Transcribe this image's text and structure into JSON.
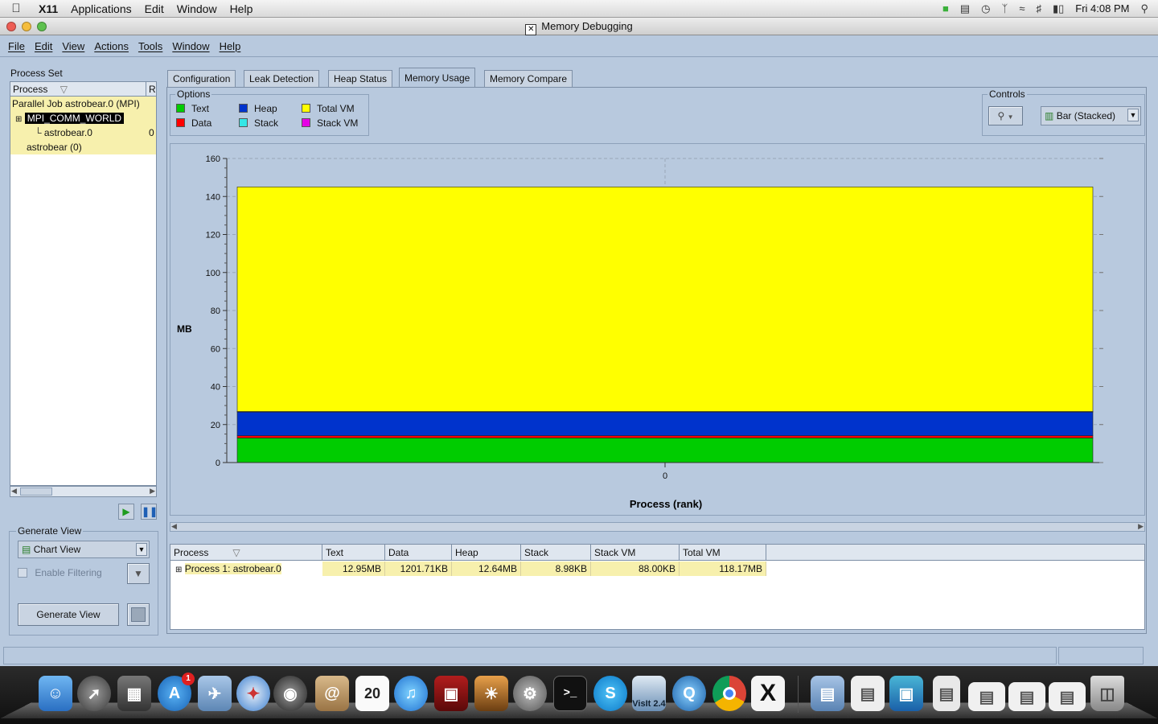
{
  "menubar": {
    "app": "X11",
    "items": [
      "Applications",
      "Edit",
      "Window",
      "Help"
    ],
    "clock": "Fri 4:08 PM"
  },
  "window": {
    "title": "Memory Debugging"
  },
  "app_menu": [
    "File",
    "Edit",
    "View",
    "Actions",
    "Tools",
    "Window",
    "Help"
  ],
  "process_set": {
    "label": "Process Set",
    "col_process": "Process",
    "col_r": "R",
    "rows": {
      "job": "Parallel Job astrobear.0 (MPI)",
      "comm": "MPI_COMM_WORLD",
      "proc": "astrobear.0",
      "proc_rank": "0",
      "bear": "astrobear (0)"
    }
  },
  "generate_view": {
    "label": "Generate View",
    "view_type": "Chart View",
    "enable_filtering": "Enable Filtering",
    "generate_button": "Generate View"
  },
  "tabs": [
    "Configuration",
    "Leak Detection",
    "Heap Status",
    "Memory Usage",
    "Memory Compare"
  ],
  "active_tab": "Memory Usage",
  "options": {
    "label": "Options",
    "items": [
      {
        "name": "Text",
        "color": "#00cc00"
      },
      {
        "name": "Data",
        "color": "#ff0000"
      },
      {
        "name": "Heap",
        "color": "#0033cc"
      },
      {
        "name": "Stack",
        "color": "#33e6e6"
      },
      {
        "name": "Total VM",
        "color": "#ffff00"
      },
      {
        "name": "Stack VM",
        "color": "#e600e6"
      }
    ]
  },
  "controls": {
    "label": "Controls",
    "chart_type": "Bar (Stacked)"
  },
  "chart_data": {
    "type": "bar",
    "stacked": true,
    "categories": [
      "0"
    ],
    "series": [
      {
        "name": "Text",
        "values": [
          12.95
        ],
        "color": "#00cc00"
      },
      {
        "name": "Data",
        "values": [
          1.17
        ],
        "color": "#ff0000"
      },
      {
        "name": "Heap",
        "values": [
          12.64
        ],
        "color": "#0033cc"
      },
      {
        "name": "Stack",
        "values": [
          0.01
        ],
        "color": "#33e6e6"
      },
      {
        "name": "Stack VM",
        "values": [
          0.09
        ],
        "color": "#e600e6"
      },
      {
        "name": "Total VM",
        "values": [
          118.17
        ],
        "color": "#ffff00"
      }
    ],
    "xlabel": "Process (rank)",
    "ylabel": "MB",
    "ylim": [
      0,
      160
    ],
    "yticks": [
      0,
      20,
      40,
      60,
      80,
      100,
      120,
      140,
      160
    ],
    "grid": true
  },
  "table": {
    "headers": [
      "Process",
      "Text",
      "Data",
      "Heap",
      "Stack",
      "Stack VM",
      "Total VM"
    ],
    "row": [
      "Process 1: astrobear.0",
      "12.95MB",
      "1201.71KB",
      "12.64MB",
      "8.98KB",
      "88.00KB",
      "118.17MB"
    ]
  },
  "dock": {
    "calendar_day": "20",
    "visit_label": "VisIt 2.4",
    "terminal_prompt": ">_",
    "x11_label": "X",
    "appstore_badge": "1"
  }
}
